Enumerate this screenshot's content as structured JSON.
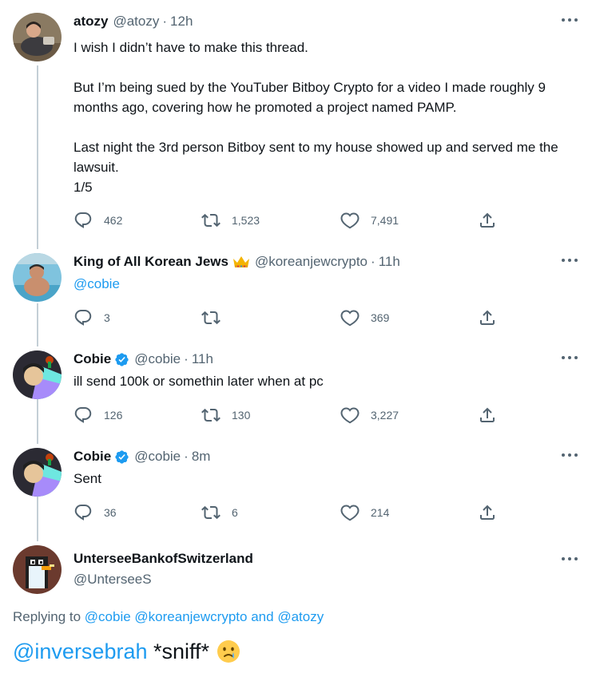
{
  "tweets": [
    {
      "name": "atozy",
      "handle": "@atozy",
      "dot": "·",
      "time": "12h",
      "text": "I wish I didn’t have to make this thread.\n\nBut I’m being sued by the YouTuber Bitboy Crypto for a video I made roughly 9 months ago, covering how he promoted a project named PAMP.\n\nLast night the 3rd person Bitboy sent to my house showed up and served me the lawsuit.\n1/5",
      "replies": "462",
      "retweets": "1,523",
      "likes": "7,491"
    },
    {
      "name": "King of All Korean Jews",
      "handle": "@koreanjewcrypto",
      "dot": "·",
      "time": "11h",
      "text": "@cobie",
      "replies": "3",
      "retweets": "",
      "likes": "369"
    },
    {
      "name": "Cobie",
      "handle": "@cobie",
      "dot": "·",
      "time": "11h",
      "text": "ill send 100k or somethin later when at pc",
      "replies": "126",
      "retweets": "130",
      "likes": "3,227"
    },
    {
      "name": "Cobie",
      "handle": "@cobie",
      "dot": "·",
      "time": "8m",
      "text": "Sent",
      "replies": "36",
      "retweets": "6",
      "likes": "214"
    }
  ],
  "focused": {
    "name": "UnterseeBankofSwitzerland",
    "handle": "@UnterseeS",
    "replying_prefix": "Replying to ",
    "replying_mentions": [
      "@cobie",
      "@koreanjewcrypto",
      "and",
      "@atozy"
    ],
    "mention": "@inversebrah",
    "body": " *sniff*"
  },
  "icons": {
    "more": "more-horizontal-icon",
    "reply": "reply-icon",
    "retweet": "retweet-icon",
    "like": "heart-icon",
    "share": "share-icon",
    "verified": "verified-badge-icon",
    "crown": "crown-emoji",
    "crying": "crying-face-emoji"
  },
  "colors": {
    "link": "#1d9bf0",
    "secondary": "#536471",
    "thread_line": "#c4cfd6",
    "verified": "#1d9bf0"
  }
}
